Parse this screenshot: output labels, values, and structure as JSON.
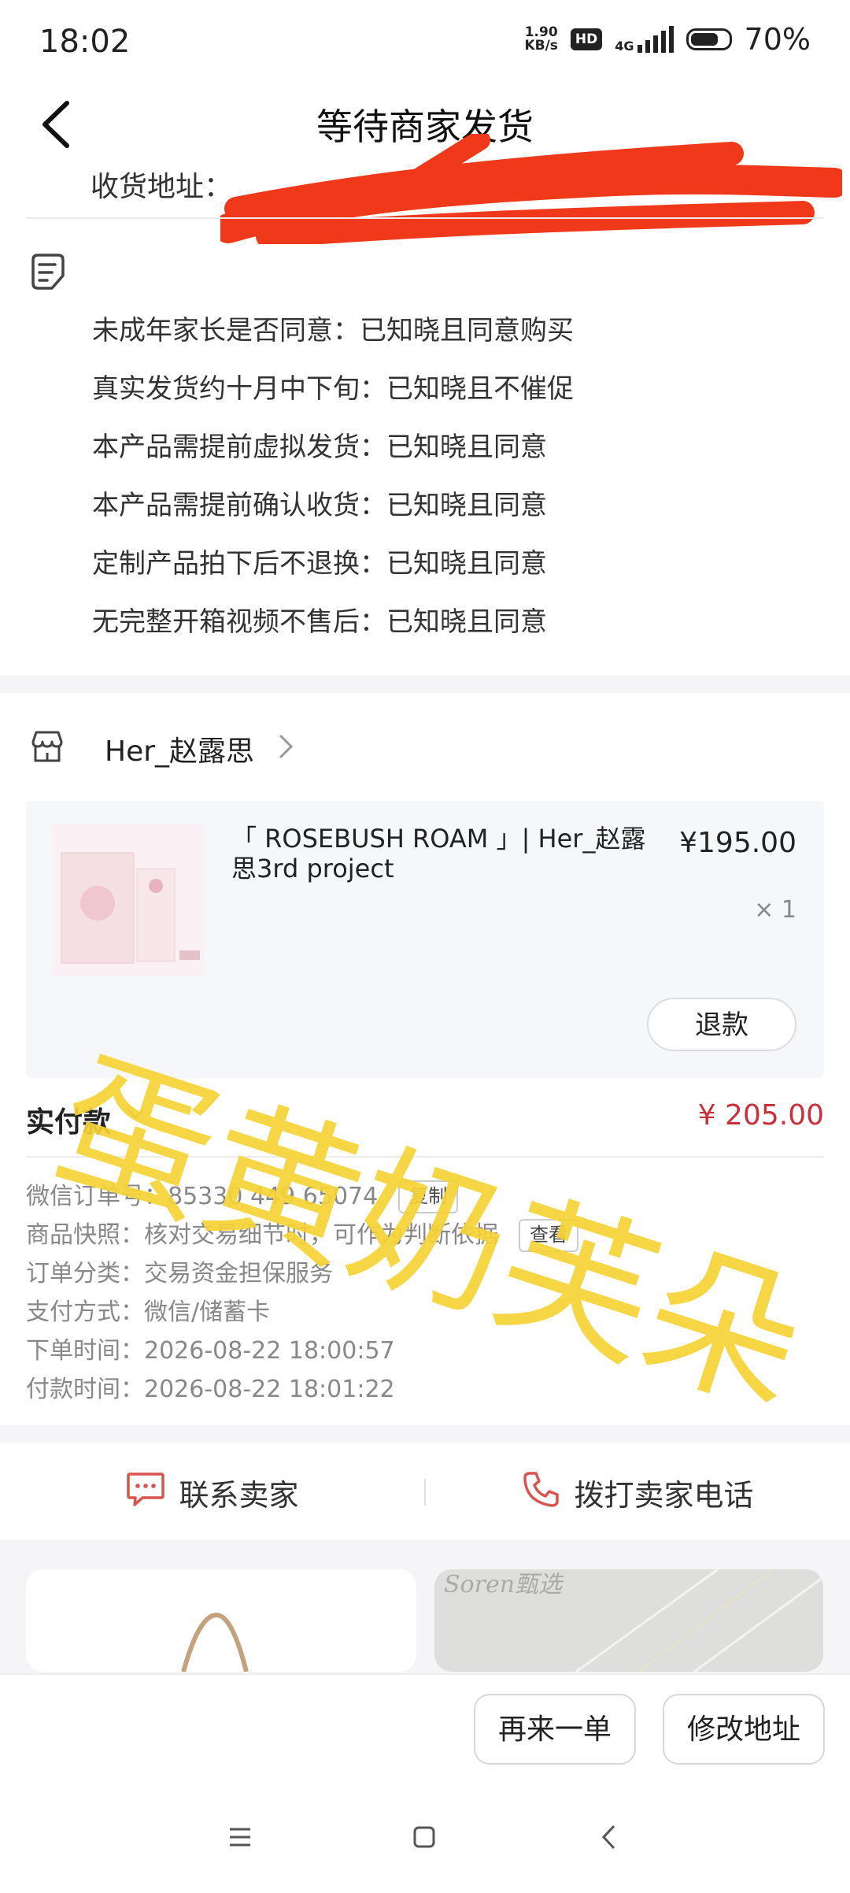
{
  "status_bar": {
    "time": "18:02",
    "net_speed_top": "1.90",
    "net_speed_bottom": "KB/s",
    "hd_badge": "HD",
    "network": "4G",
    "battery": "70%"
  },
  "header": {
    "title": "等待商家发货",
    "address_label": "收货地址："
  },
  "notes": [
    "未成年家长是否同意：已知晓且同意购买",
    "真实发货约十月中下旬：已知晓且不催促",
    "本产品需提前虚拟发货：已知晓且同意",
    "本产品需提前确认收货：已知晓且同意",
    "定制产品拍下后不退换：已知晓且同意",
    "无完整开箱视频不售后：已知晓且同意"
  ],
  "shop": {
    "name": "Her_赵露思"
  },
  "product": {
    "title": "「 ROSEBUSH ROAM 」| Her_赵露思3rd project",
    "price": "¥195.00",
    "quantity": "× 1",
    "refund_label": "退款"
  },
  "payment": {
    "label": "实付款",
    "amount": "¥ 205.00"
  },
  "order_info": {
    "order_no_label": "微信订单号：",
    "order_no": "85330 449 65074",
    "copy_label": "复制",
    "snapshot_label": "商品快照：",
    "snapshot_text": "核对交易细节时，可作为判断依据",
    "view_label": "查看",
    "category_label": "订单分类：",
    "category": "交易资金担保服务",
    "pay_method_label": "支付方式：",
    "pay_method": "微信/储蓄卡",
    "order_time_label": "下单时间：",
    "order_time": "2026-08-22 18:00:57",
    "pay_time_label": "付款时间：",
    "pay_time": "2026-08-22 18:01:22"
  },
  "contact": {
    "chat_label": "联系卖家",
    "call_label": "拨打卖家电话"
  },
  "recommend": {
    "brand_text": "Soren甄选"
  },
  "bottom_actions": {
    "reorder_label": "再来一单",
    "change_address_label": "修改地址"
  },
  "watermark": {
    "text": "蛋黄奶芙朵",
    "color": "#f5d334"
  },
  "colors": {
    "price_red": "#c9303a",
    "icon_red": "#d9544f"
  }
}
